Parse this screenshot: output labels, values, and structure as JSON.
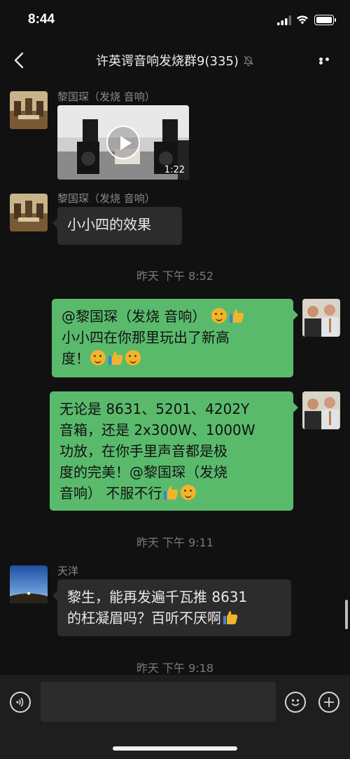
{
  "status": {
    "time": "8:44"
  },
  "header": {
    "title": "许英谔音响发烧群9(335)"
  },
  "messages": [
    {
      "sender": "黎国琛（发烧 音响）",
      "type": "video",
      "duration": "1:22"
    },
    {
      "sender": "黎国琛（发烧 音响）",
      "text": "小小四的效果"
    },
    {
      "timestamp": "昨天 下午 8:52"
    },
    {
      "lines": [
        "@黎国琛（发烧 音响）",
        "小小四在你那里玩出了新高",
        "度！"
      ]
    },
    {
      "lines": [
        "无论是 8631、5201、4202Y",
        "音箱，还是 2x300W、1000W",
        "功放，在你手里声音都是极",
        "度的完美！@黎国琛（发烧",
        "音响） 不服不行"
      ]
    },
    {
      "timestamp": "昨天 下午 9:11"
    },
    {
      "sender": "天洋",
      "lines": [
        "黎生，能再发遍千瓦推 8631",
        "的枉凝眉吗？百听不厌啊"
      ]
    },
    {
      "timestamp": "昨天 下午 9:18"
    }
  ],
  "input": {
    "placeholder": ""
  },
  "icons": {
    "back": "chevron-left-icon",
    "mute": "bell-off-icon",
    "more": "more-dots-icon",
    "voice": "voice-icon",
    "emoji": "emoji-icon",
    "add": "plus-icon",
    "play": "play-icon",
    "reaction_emoji": "hugging-face-icon",
    "reaction_thumb": "thumbs-up-icon"
  },
  "colors": {
    "background": "#111111",
    "outgoing_bubble": "#5aba6c",
    "incoming_bubble": "#2c2c2c"
  }
}
